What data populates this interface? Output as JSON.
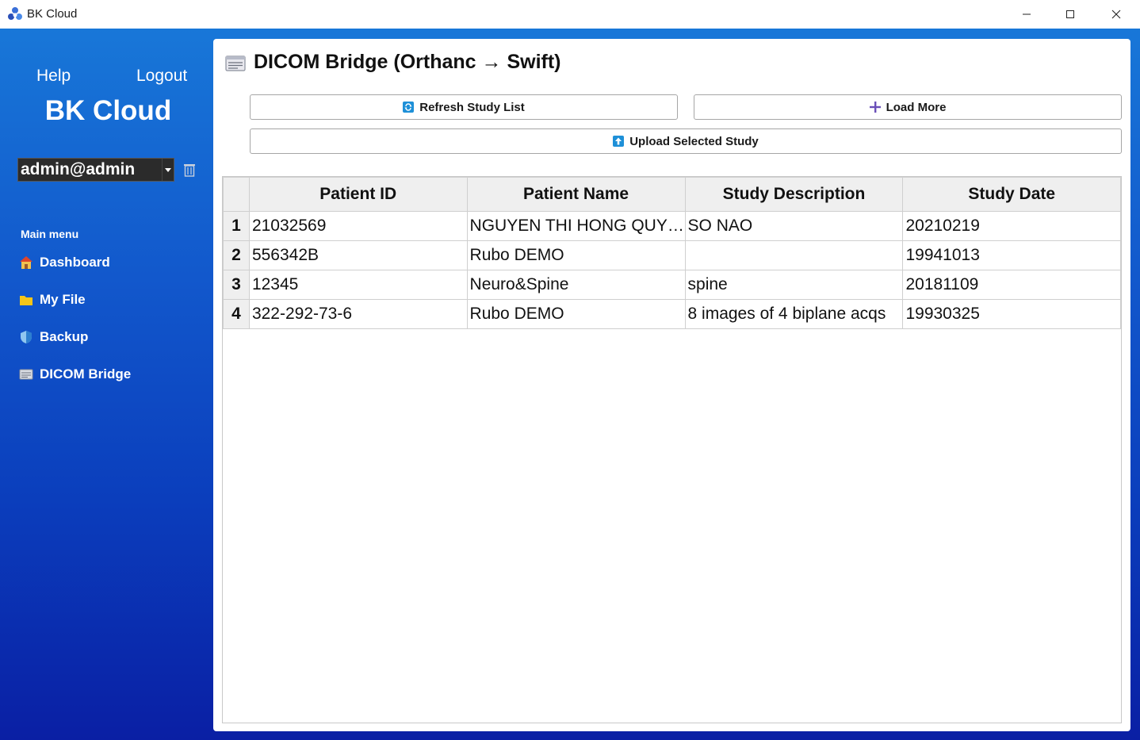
{
  "window": {
    "title": "BK Cloud",
    "controls": {
      "minimize": "minimize-icon",
      "maximize": "maximize-icon",
      "close": "close-icon"
    }
  },
  "sidebar": {
    "help_label": "Help",
    "logout_label": "Logout",
    "brand": "BK Cloud",
    "account_select": {
      "value": "admin@admin"
    },
    "menu_title": "Main menu",
    "items": [
      {
        "label": "Dashboard",
        "icon": "house-icon"
      },
      {
        "label": "My File",
        "icon": "folder-icon"
      },
      {
        "label": "Backup",
        "icon": "shield-icon"
      },
      {
        "label": "DICOM Bridge",
        "icon": "card-icon"
      }
    ]
  },
  "main": {
    "title": "DICOM Bridge (Orthanc → Swift)",
    "buttons": {
      "refresh": "Refresh Study List",
      "load_more": "Load More",
      "upload": "Upload Selected Study"
    },
    "table": {
      "columns": [
        "Patient ID",
        "Patient Name",
        "Study Description",
        "Study Date"
      ],
      "rows": [
        {
          "n": "1",
          "cells": [
            "21032569",
            "NGUYEN THI HONG QUYE...",
            "SO NAO",
            "20210219"
          ]
        },
        {
          "n": "2",
          "cells": [
            "556342B",
            "Rubo DEMO",
            "",
            "19941013"
          ]
        },
        {
          "n": "3",
          "cells": [
            "12345",
            "Neuro&Spine",
            "spine",
            "20181109"
          ]
        },
        {
          "n": "4",
          "cells": [
            "322-292-73-6",
            "Rubo DEMO",
            "8 images of 4 biplane acqs",
            "19930325"
          ]
        }
      ]
    }
  },
  "colors": {
    "gradient_top": "#1877d8",
    "gradient_bottom": "#0a1fa4",
    "panel_bg": "#ffffff"
  }
}
